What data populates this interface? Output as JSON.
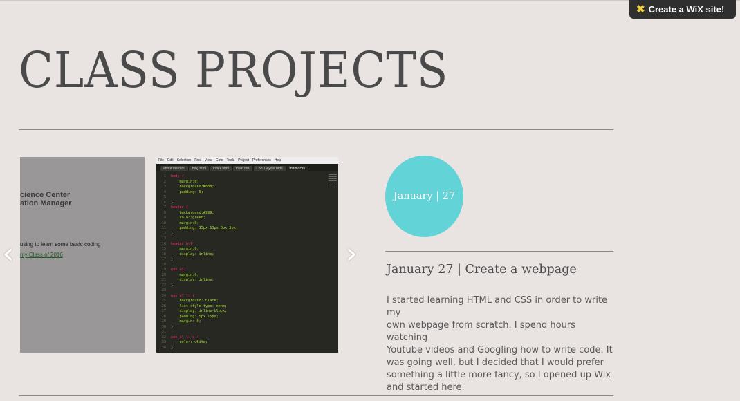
{
  "badge": {
    "label": "Create a WiX site!",
    "icon": "wix-logo-icon"
  },
  "page": {
    "title": "CLASS PROJECTS"
  },
  "gallery": {
    "slide_left": {
      "line1": "cience Center",
      "line2": "ation Manager",
      "line3": "using to learn some basic coding",
      "line4": "my Class of 2016"
    },
    "slide_code": {
      "menu": [
        "File",
        "Edit",
        "Selection",
        "Find",
        "View",
        "Goto",
        "Tools",
        "Project",
        "Preferences",
        "Help"
      ],
      "tabs": [
        "about me.html",
        "blog.html",
        "index.html",
        "main.css",
        "CSS LAyout.html",
        "main2.css"
      ]
    },
    "prev_icon": "chevron-left-icon",
    "next_icon": "chevron-right-icon"
  },
  "post": {
    "date_badge": "January | 27",
    "title": "January 27 | Create a webpage",
    "body": "I started learning HTML and CSS in order to write my\nown webpage from scratch.  I spend hours watching\nYoutube videos and Googling how to write code.  It\nwas going well, but I decided that I would prefer\nsomething a little more fancy, so I opened up Wix\nand started here."
  },
  "colors": {
    "background": "#e9e3e2",
    "accent": "#62d3d7",
    "title": "#4a4a4a"
  }
}
